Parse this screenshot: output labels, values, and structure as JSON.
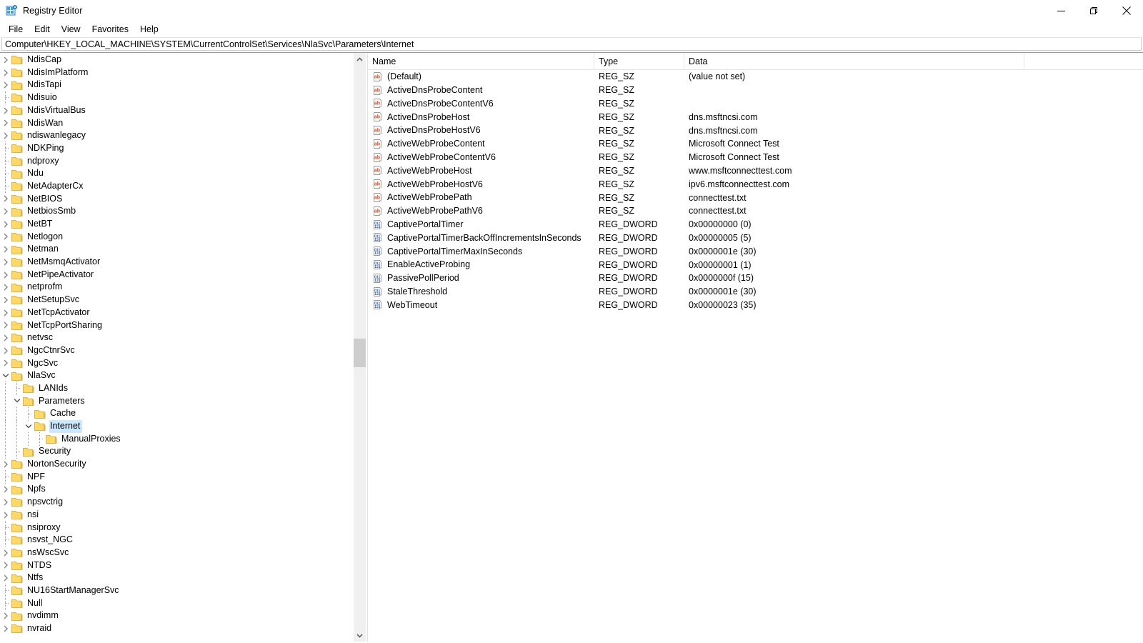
{
  "window": {
    "title": "Registry Editor",
    "icon": "registry-editor-icon",
    "controls": {
      "minimize": "minimize-button",
      "restore": "restore-button",
      "close": "close-button"
    }
  },
  "menubar": {
    "items": [
      {
        "label": "File"
      },
      {
        "label": "Edit"
      },
      {
        "label": "View"
      },
      {
        "label": "Favorites"
      },
      {
        "label": "Help"
      }
    ]
  },
  "address": {
    "path": "Computer\\HKEY_LOCAL_MACHINE\\SYSTEM\\CurrentControlSet\\Services\\NlaSvc\\Parameters\\Internet"
  },
  "tree": {
    "items": [
      {
        "label": "NdisCap",
        "depth": 0,
        "state": "collapsed",
        "selected": false
      },
      {
        "label": "NdisImPlatform",
        "depth": 0,
        "state": "collapsed",
        "selected": false
      },
      {
        "label": "NdisTapi",
        "depth": 0,
        "state": "collapsed",
        "selected": false
      },
      {
        "label": "Ndisuio",
        "depth": 0,
        "state": "leaf",
        "selected": false
      },
      {
        "label": "NdisVirtualBus",
        "depth": 0,
        "state": "collapsed",
        "selected": false
      },
      {
        "label": "NdisWan",
        "depth": 0,
        "state": "collapsed",
        "selected": false
      },
      {
        "label": "ndiswanlegacy",
        "depth": 0,
        "state": "collapsed",
        "selected": false
      },
      {
        "label": "NDKPing",
        "depth": 0,
        "state": "leaf",
        "selected": false
      },
      {
        "label": "ndproxy",
        "depth": 0,
        "state": "leaf",
        "selected": false
      },
      {
        "label": "Ndu",
        "depth": 0,
        "state": "leaf",
        "selected": false
      },
      {
        "label": "NetAdapterCx",
        "depth": 0,
        "state": "leaf",
        "selected": false
      },
      {
        "label": "NetBIOS",
        "depth": 0,
        "state": "collapsed",
        "selected": false
      },
      {
        "label": "NetbiosSmb",
        "depth": 0,
        "state": "collapsed",
        "selected": false
      },
      {
        "label": "NetBT",
        "depth": 0,
        "state": "collapsed",
        "selected": false
      },
      {
        "label": "Netlogon",
        "depth": 0,
        "state": "collapsed",
        "selected": false
      },
      {
        "label": "Netman",
        "depth": 0,
        "state": "collapsed",
        "selected": false
      },
      {
        "label": "NetMsmqActivator",
        "depth": 0,
        "state": "collapsed",
        "selected": false
      },
      {
        "label": "NetPipeActivator",
        "depth": 0,
        "state": "collapsed",
        "selected": false
      },
      {
        "label": "netprofm",
        "depth": 0,
        "state": "collapsed",
        "selected": false
      },
      {
        "label": "NetSetupSvc",
        "depth": 0,
        "state": "collapsed",
        "selected": false
      },
      {
        "label": "NetTcpActivator",
        "depth": 0,
        "state": "collapsed",
        "selected": false
      },
      {
        "label": "NetTcpPortSharing",
        "depth": 0,
        "state": "collapsed",
        "selected": false
      },
      {
        "label": "netvsc",
        "depth": 0,
        "state": "collapsed",
        "selected": false
      },
      {
        "label": "NgcCtnrSvc",
        "depth": 0,
        "state": "collapsed",
        "selected": false
      },
      {
        "label": "NgcSvc",
        "depth": 0,
        "state": "collapsed",
        "selected": false
      },
      {
        "label": "NlaSvc",
        "depth": 0,
        "state": "expanded",
        "selected": false
      },
      {
        "label": "LANIds",
        "depth": 1,
        "state": "leaf",
        "selected": false
      },
      {
        "label": "Parameters",
        "depth": 1,
        "state": "expanded",
        "selected": false
      },
      {
        "label": "Cache",
        "depth": 2,
        "state": "leaf",
        "selected": false
      },
      {
        "label": "Internet",
        "depth": 2,
        "state": "expanded",
        "selected": true
      },
      {
        "label": "ManualProxies",
        "depth": 3,
        "state": "leaf",
        "selected": false
      },
      {
        "label": "Security",
        "depth": 1,
        "state": "leaf",
        "selected": false
      },
      {
        "label": "NortonSecurity",
        "depth": 0,
        "state": "collapsed",
        "selected": false
      },
      {
        "label": "NPF",
        "depth": 0,
        "state": "leaf",
        "selected": false
      },
      {
        "label": "Npfs",
        "depth": 0,
        "state": "collapsed",
        "selected": false
      },
      {
        "label": "npsvctrig",
        "depth": 0,
        "state": "collapsed",
        "selected": false
      },
      {
        "label": "nsi",
        "depth": 0,
        "state": "collapsed",
        "selected": false
      },
      {
        "label": "nsiproxy",
        "depth": 0,
        "state": "leaf",
        "selected": false
      },
      {
        "label": "nsvst_NGC",
        "depth": 0,
        "state": "leaf",
        "selected": false
      },
      {
        "label": "nsWscSvc",
        "depth": 0,
        "state": "collapsed",
        "selected": false
      },
      {
        "label": "NTDS",
        "depth": 0,
        "state": "collapsed",
        "selected": false
      },
      {
        "label": "Ntfs",
        "depth": 0,
        "state": "collapsed",
        "selected": false
      },
      {
        "label": "NU16StartManagerSvc",
        "depth": 0,
        "state": "leaf",
        "selected": false
      },
      {
        "label": "Null",
        "depth": 0,
        "state": "leaf",
        "selected": false
      },
      {
        "label": "nvdimm",
        "depth": 0,
        "state": "collapsed",
        "selected": false
      },
      {
        "label": "nvraid",
        "depth": 0,
        "state": "collapsed",
        "selected": false
      }
    ]
  },
  "list": {
    "columns": [
      {
        "label": "Name"
      },
      {
        "label": "Type"
      },
      {
        "label": "Data"
      }
    ],
    "rows": [
      {
        "icon": "string-value-icon",
        "name": "(Default)",
        "type": "REG_SZ",
        "data": "(value not set)"
      },
      {
        "icon": "string-value-icon",
        "name": "ActiveDnsProbeContent",
        "type": "REG_SZ",
        "data": ""
      },
      {
        "icon": "string-value-icon",
        "name": "ActiveDnsProbeContentV6",
        "type": "REG_SZ",
        "data": ""
      },
      {
        "icon": "string-value-icon",
        "name": "ActiveDnsProbeHost",
        "type": "REG_SZ",
        "data": "dns.msftncsi.com"
      },
      {
        "icon": "string-value-icon",
        "name": "ActiveDnsProbeHostV6",
        "type": "REG_SZ",
        "data": "dns.msftncsi.com"
      },
      {
        "icon": "string-value-icon",
        "name": "ActiveWebProbeContent",
        "type": "REG_SZ",
        "data": "Microsoft Connect Test"
      },
      {
        "icon": "string-value-icon",
        "name": "ActiveWebProbeContentV6",
        "type": "REG_SZ",
        "data": "Microsoft Connect Test"
      },
      {
        "icon": "string-value-icon",
        "name": "ActiveWebProbeHost",
        "type": "REG_SZ",
        "data": "www.msftconnecttest.com"
      },
      {
        "icon": "string-value-icon",
        "name": "ActiveWebProbeHostV6",
        "type": "REG_SZ",
        "data": "ipv6.msftconnecttest.com"
      },
      {
        "icon": "string-value-icon",
        "name": "ActiveWebProbePath",
        "type": "REG_SZ",
        "data": "connecttest.txt"
      },
      {
        "icon": "string-value-icon",
        "name": "ActiveWebProbePathV6",
        "type": "REG_SZ",
        "data": "connecttest.txt"
      },
      {
        "icon": "dword-value-icon",
        "name": "CaptivePortalTimer",
        "type": "REG_DWORD",
        "data": "0x00000000 (0)"
      },
      {
        "icon": "dword-value-icon",
        "name": "CaptivePortalTimerBackOffIncrementsInSeconds",
        "type": "REG_DWORD",
        "data": "0x00000005 (5)"
      },
      {
        "icon": "dword-value-icon",
        "name": "CaptivePortalTimerMaxInSeconds",
        "type": "REG_DWORD",
        "data": "0x0000001e (30)"
      },
      {
        "icon": "dword-value-icon",
        "name": "EnableActiveProbing",
        "type": "REG_DWORD",
        "data": "0x00000001 (1)"
      },
      {
        "icon": "dword-value-icon",
        "name": "PassivePollPeriod",
        "type": "REG_DWORD",
        "data": "0x0000000f (15)"
      },
      {
        "icon": "dword-value-icon",
        "name": "StaleThreshold",
        "type": "REG_DWORD",
        "data": "0x0000001e (30)"
      },
      {
        "icon": "dword-value-icon",
        "name": "WebTimeout",
        "type": "REG_DWORD",
        "data": "0x00000023 (35)"
      }
    ]
  },
  "colors": {
    "selection": "#cce8ff",
    "folder": "#ffd966",
    "string_icon": "#d94a1e",
    "dword_icon": "#2b5fb5",
    "scrollbar_thumb": "#cdcdcd"
  }
}
